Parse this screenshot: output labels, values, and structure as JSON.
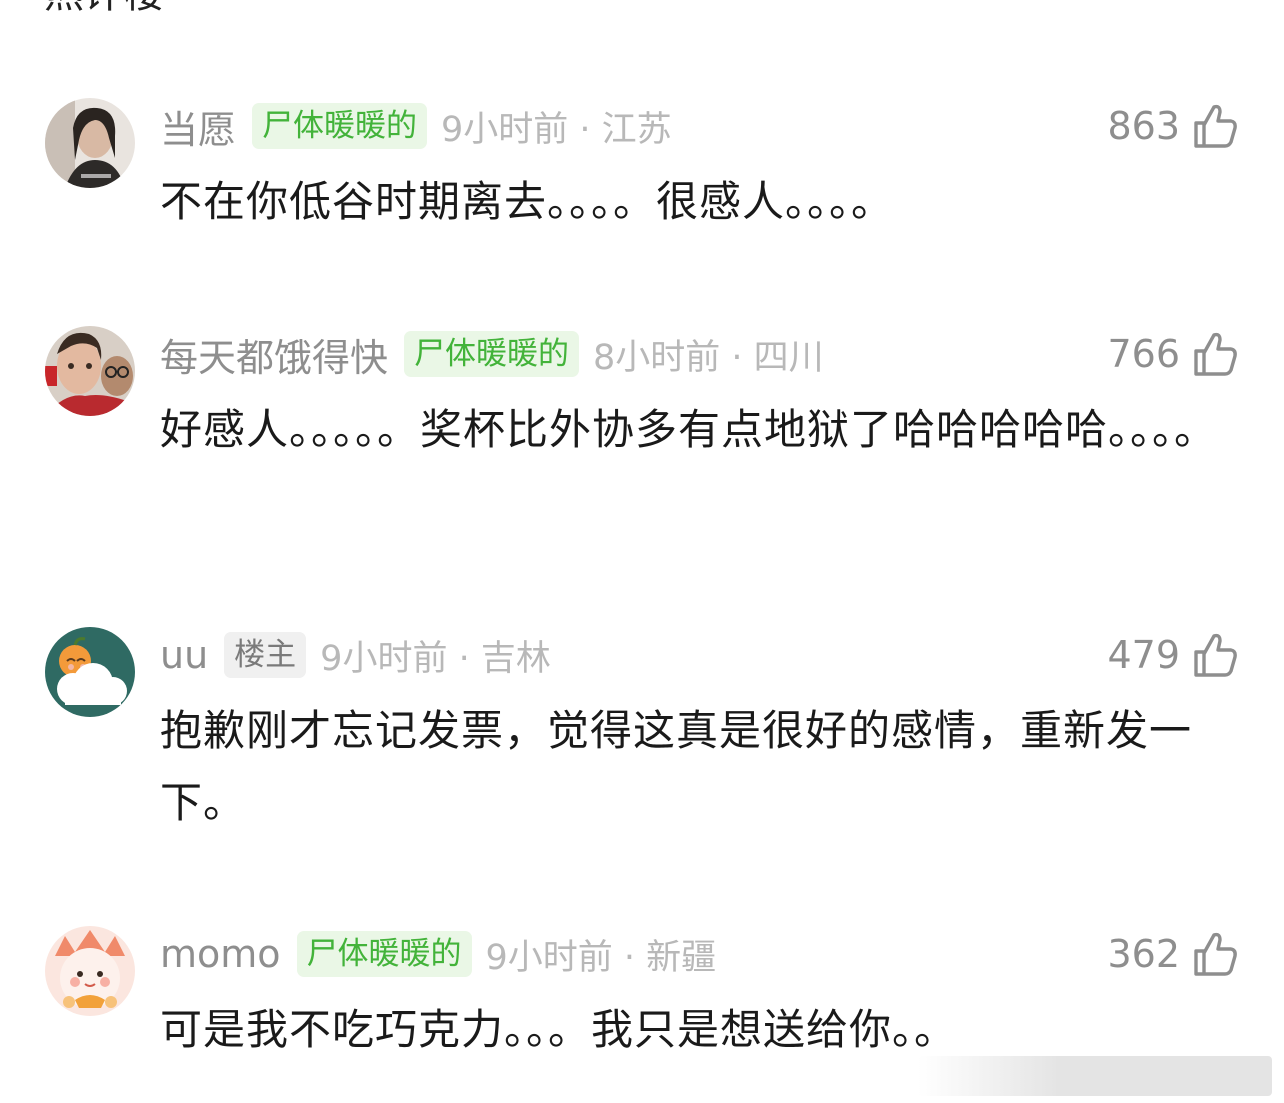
{
  "top_fragment": "热评楼",
  "comments": [
    {
      "username": "当愿",
      "tag": "尸体暖暖的",
      "time_location": "9小时前 · 江苏",
      "likes": "863",
      "content": "不在你低谷时期离去。。。。很感人。。。。"
    },
    {
      "username": "每天都饿得快",
      "tag": "尸体暖暖的",
      "time_location": "8小时前 · 四川",
      "likes": "766",
      "content": "好感人。。。。。奖杯比外协多有点地狱了哈哈哈哈哈。。。。"
    },
    {
      "username": "uu",
      "tag": "楼主",
      "time_location": "9小时前 · 吉林",
      "likes": "479",
      "content": "抱歉刚才忘记发票，觉得这真是很好的感情，重新发一下。"
    },
    {
      "username": "momo",
      "tag": "尸体暖暖的",
      "time_location": "9小时前 · 新疆",
      "likes": "362",
      "content": "可是我不吃巧克力。。。我只是想送给你。。"
    }
  ],
  "colors": {
    "fan_tag_bg": "#eaf7e6",
    "fan_tag_text": "#43b33a",
    "op_tag_bg": "#f0f0f0",
    "meta_text": "#b8b8b8",
    "username_text": "#8e8e8e"
  },
  "icons": {
    "like": "thumbs-up-icon"
  }
}
